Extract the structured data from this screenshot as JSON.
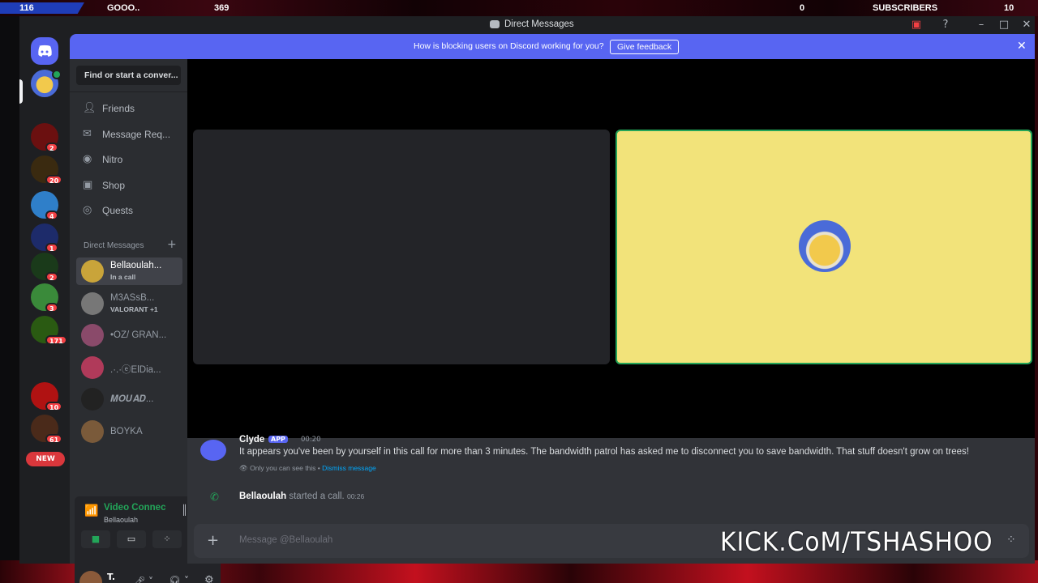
{
  "overlay": {
    "left_count": "116",
    "left_name": "GOOO..",
    "mid_count": "369",
    "right_zero": "0",
    "subs_label": "SUBSCRIBERS",
    "subs_count": "10",
    "kick_text": "KICK.CoM/TSHASHOO"
  },
  "window": {
    "title": "Direct Messages"
  },
  "notice": {
    "text": "How is blocking users on Discord working for you?",
    "button": "Give feedback"
  },
  "servers": [
    {
      "badge": "2",
      "color": "#6b1010"
    },
    {
      "badge": "20",
      "color": "#3a2a10"
    },
    {
      "badge": "4",
      "color": "#2f7fc9"
    },
    {
      "badge": "1",
      "color": "#1d2b6a"
    },
    {
      "badge": "2",
      "color": "#1a3a1a"
    },
    {
      "badge": "3",
      "color": "#3a8a3a"
    },
    {
      "badge": "171",
      "color": "#2a5a12"
    },
    {
      "badge": "10",
      "color": "#b01212"
    },
    {
      "badge": "61",
      "color": "#4a2a1a"
    }
  ],
  "new_label": "NEW",
  "search": {
    "placeholder": "Find or start a conver..."
  },
  "nav": [
    {
      "label": "Friends",
      "icon": "friends-icon"
    },
    {
      "label": "Message Req...",
      "icon": "mail-icon"
    },
    {
      "label": "Nitro",
      "icon": "nitro-icon"
    },
    {
      "label": "Shop",
      "icon": "shop-icon"
    },
    {
      "label": "Quests",
      "icon": "quests-icon"
    }
  ],
  "dm_header": "Direct Messages",
  "dms": [
    {
      "name": "Bellaoulah...",
      "sub": "In a call",
      "color": "#c9a43a"
    },
    {
      "name": "M3ASsB...",
      "sub": "VALORANT +1",
      "color": "#777"
    },
    {
      "name": "•OZ/ GRAN...",
      "sub": "",
      "color": "#8a4a6a"
    },
    {
      "name": ".·.·ⓔElDia...",
      "sub": "",
      "color": "#b03a5a"
    },
    {
      "name": "𝑴𝑶𝑼𝑨𝑫...",
      "sub": "",
      "color": "#222"
    },
    {
      "name": "BOYKA",
      "sub": "",
      "color": "#7a5a3a"
    }
  ],
  "voice": {
    "status": "Video Connec",
    "channel": "Bellaoulah"
  },
  "user": {
    "initial": "T."
  },
  "chat": {
    "bot_name": "Clyde",
    "bot_tag": "APP",
    "bot_time": "00:20",
    "bot_text": "It appears you've been by yourself in this call for more than 3 minutes. The bandwidth patrol has asked me to disconnect you to save bandwidth. That stuff doesn't grow on trees!",
    "only_you": "Only you can see this •",
    "dismiss": "Dismiss message",
    "call_user": "Bellaoulah",
    "call_text": "started a call.",
    "call_time": "00:26",
    "input_placeholder": "Message @Bellaoulah"
  },
  "colors": {
    "blurple": "#5865f2",
    "green": "#23a559",
    "red": "#f23f43",
    "tile_yellow": "#f2e37a"
  }
}
